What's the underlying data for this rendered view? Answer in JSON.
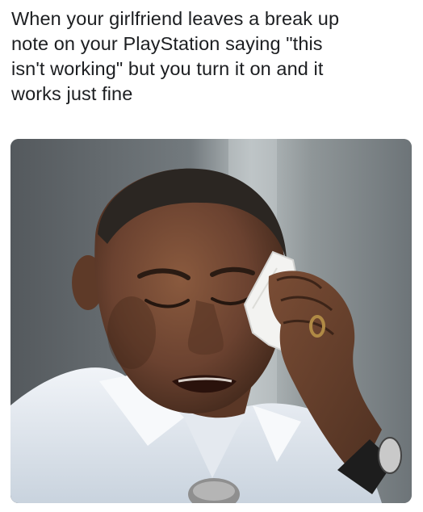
{
  "caption": {
    "text": "When your girlfriend leaves a break up\nnote on your PlayStation saying \"this\nisn't working\" but you turn it on and it\nworks just fine"
  },
  "photo": {
    "colors": {
      "background_left": "#5d6266",
      "background_right": "#a9afb2",
      "skin": "#6e4530",
      "skin_shadow": "#4a2c1e",
      "hair": "#2d2824",
      "shirt": "#dfe6ee",
      "cloth": "#f2f2f0",
      "watch": "#1f1f1f"
    }
  }
}
